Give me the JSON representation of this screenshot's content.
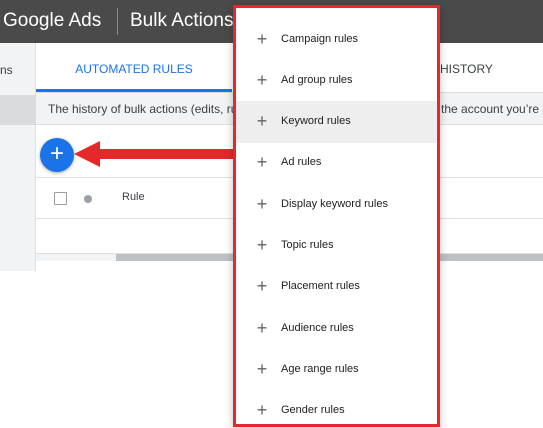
{
  "topbar": {
    "brand": "Google Ads",
    "page_title": "Bulk Actions"
  },
  "leftnav": {
    "partial_label": "ns"
  },
  "tabs": {
    "automated_rules": "AUTOMATED RULES",
    "history_partial": "HISTORY"
  },
  "infobar": {
    "left_text": "The history of bulk actions (edits, rules",
    "right_text": "the account you’re si"
  },
  "fab": {
    "icon": "plus-icon",
    "label": "+"
  },
  "table": {
    "rule_header": "Rule"
  },
  "menu": {
    "items": [
      {
        "label": "Campaign rules"
      },
      {
        "label": "Ad group rules"
      },
      {
        "label": "Keyword rules",
        "hovered": true
      },
      {
        "label": "Ad rules"
      },
      {
        "label": "Display keyword rules"
      },
      {
        "label": "Topic rules"
      },
      {
        "label": "Placement rules"
      },
      {
        "label": "Audience rules"
      },
      {
        "label": "Age range rules"
      },
      {
        "label": "Gender rules"
      }
    ]
  },
  "colors": {
    "accent": "#1a73e8",
    "annotation_red": "#e52829",
    "topbar": "#4a4a4a"
  }
}
